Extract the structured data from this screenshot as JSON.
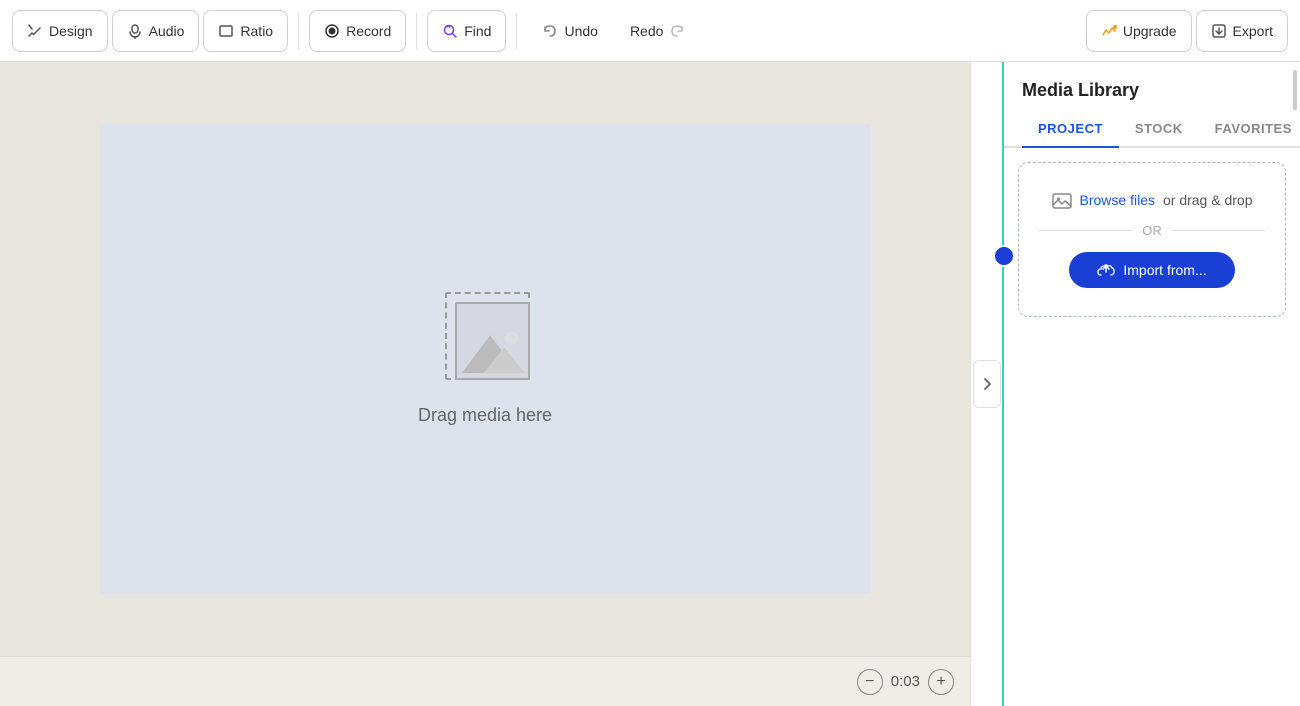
{
  "toolbar": {
    "design_label": "Design",
    "audio_label": "Audio",
    "ratio_label": "Ratio",
    "record_label": "Record",
    "find_label": "Find",
    "undo_label": "Undo",
    "redo_label": "Redo",
    "upgrade_label": "Upgrade",
    "export_label": "Export"
  },
  "canvas": {
    "drag_label": "Drag media here"
  },
  "timeline": {
    "time": "0:03"
  },
  "media_library": {
    "title": "Media Library",
    "tabs": [
      {
        "id": "project",
        "label": "PROJECT",
        "active": true
      },
      {
        "id": "stock",
        "label": "STOCK",
        "active": false
      },
      {
        "id": "favorites",
        "label": "FAVORITES",
        "active": false
      }
    ],
    "upload": {
      "browse_text": "Browse files",
      "browse_after": "or drag & drop",
      "or_label": "OR",
      "import_label": "Import from..."
    }
  }
}
